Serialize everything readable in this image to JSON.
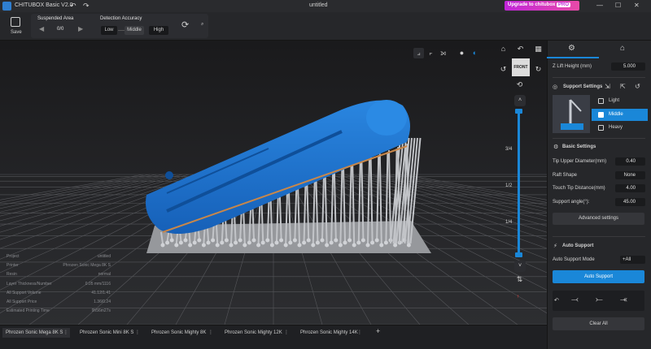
{
  "titlebar": {
    "app_name": "CHITUBOX Basic V2.0",
    "document": "untitled",
    "upgrade_text": "Upgrade to chitubox",
    "upgrade_badge": "PRO",
    "undo": "↶",
    "redo": "↷"
  },
  "toolbar": {
    "save_label": "Save",
    "suspended_area_label": "Suspended Area",
    "suspended_count": "0/0",
    "detection_accuracy_label": "Detection Accuracy",
    "accuracy_options": [
      "Low",
      "Middle",
      "High"
    ],
    "accuracy_selected": "Middle"
  },
  "viewport": {
    "ruler": [
      "3/4",
      "1/2",
      "1/4"
    ],
    "front_label": "FRONT",
    "info": [
      {
        "label": "Project",
        "value": "untitled"
      },
      {
        "label": "Printer",
        "value": "Phrozen Sonic Mega 8K S"
      },
      {
        "label": "Resin",
        "value": "normal"
      },
      {
        "label": "Layer Thickness/Number",
        "value": "0.05 mm/1116"
      },
      {
        "label": "All Support Volume",
        "value": "41.12/1.41"
      },
      {
        "label": "All Support Price",
        "value": "1.36/0.24"
      },
      {
        "label": "Estimated Printing Time",
        "value": "9h56m27s"
      }
    ]
  },
  "printer_tabs": [
    "Phrozen Sonic Mega 8K S",
    "Phrozen Sonic Mini 8K S",
    "Phrozen Sonic Mighty 8K",
    "Phrozen Sonic Mighty 12K",
    "Phrozen Sonic Mighty 14K"
  ],
  "panel": {
    "z_lift_label": "Z Lift Height (mm)",
    "z_lift_value": "5.000",
    "support_settings": "Support Settings",
    "presets": [
      "Light",
      "Middle",
      "Heavy"
    ],
    "preset_selected": "Middle",
    "basic_settings": "Basic Settings",
    "params": [
      {
        "label": "Tip Upper Diameter(mm)",
        "value": "0.40"
      },
      {
        "label": "Raft Shape",
        "value": "None"
      },
      {
        "label": "Touch Tip Distance(mm)",
        "value": "4.00"
      },
      {
        "label": "Support angle(°):",
        "value": "45.00"
      }
    ],
    "advanced_settings": "Advanced settings",
    "auto_support_title": "Auto Support",
    "auto_support_mode_label": "Auto Support Mode",
    "auto_support_mode_value": "+All",
    "auto_support_button": "Auto Support",
    "clear_all": "Clear All"
  },
  "colors": {
    "accent": "#1a87d8",
    "model": "#1f74cf",
    "support": "#b9bcc2",
    "plate": "#9a9ca0",
    "grid": "#5b5c60"
  }
}
